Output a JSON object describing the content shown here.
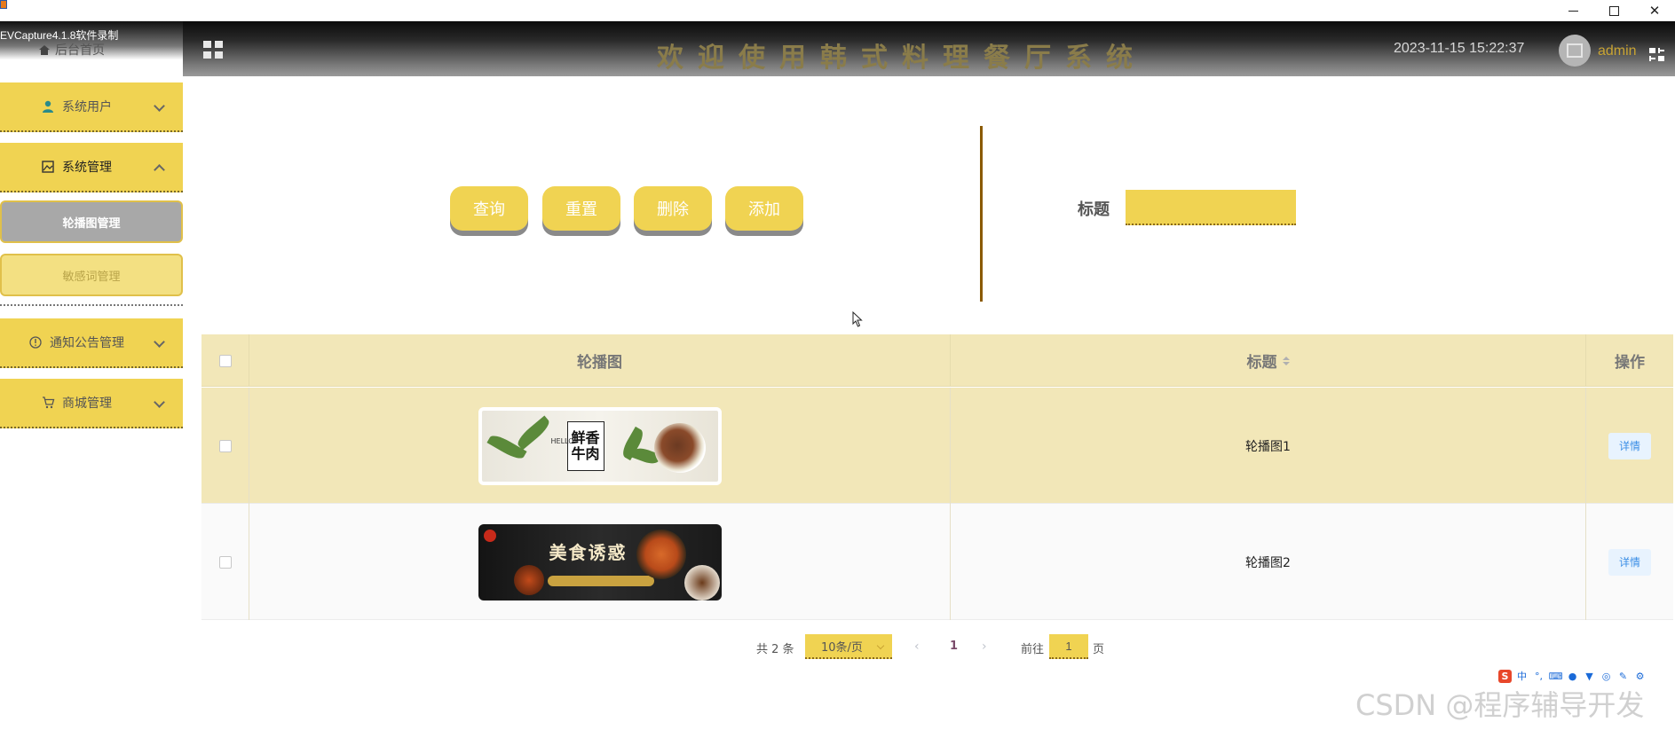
{
  "window": {
    "recorder_label": "EVCapture4.1.8软件录制"
  },
  "header": {
    "title": "欢迎使用韩式料理餐厅系统",
    "datetime": "2023-11-15 15:22:37",
    "username": "admin"
  },
  "sidebar": {
    "home": "后台首页",
    "items": [
      {
        "label": "系统用户",
        "icon": "user-icon",
        "expanded": false
      },
      {
        "label": "系统管理",
        "icon": "image-icon",
        "expanded": true
      },
      {
        "label": "通知公告管理",
        "icon": "info-circle-icon",
        "expanded": false
      },
      {
        "label": "商城管理",
        "icon": "cart-icon",
        "expanded": false
      }
    ],
    "submenu": [
      {
        "label": "轮播图管理",
        "active": true
      },
      {
        "label": "敏感词管理",
        "active": false
      }
    ]
  },
  "toolbar": {
    "query_label": "查询",
    "reset_label": "重置",
    "delete_label": "删除",
    "add_label": "添加"
  },
  "search": {
    "title_label": "标题",
    "title_value": ""
  },
  "table": {
    "columns": [
      "轮播图",
      "标题",
      "操作"
    ],
    "rows": [
      {
        "title": "轮播图1",
        "banner_text": "鲜香牛肉",
        "banner_sub": "HELLO",
        "action": "详情"
      },
      {
        "title": "轮播图2",
        "banner_text": "美食诱惑",
        "banner_sub": "",
        "action": "详情"
      }
    ]
  },
  "pagination": {
    "total": "共 2 条",
    "page_size": "10条/页",
    "prev": "‹",
    "current_page": "1",
    "next": "›",
    "goto_label": "前往",
    "goto_value": "1",
    "page_suffix": "页"
  },
  "ime": {
    "logo": "S",
    "lang": "中"
  },
  "watermark": "CSDN @程序辅导开发",
  "colors": {
    "accent_yellow": "#f0d352",
    "table_header_bg": "#f2e7b8",
    "divider_brown": "#8a5a00",
    "detail_blue": "#3a8ee6"
  }
}
